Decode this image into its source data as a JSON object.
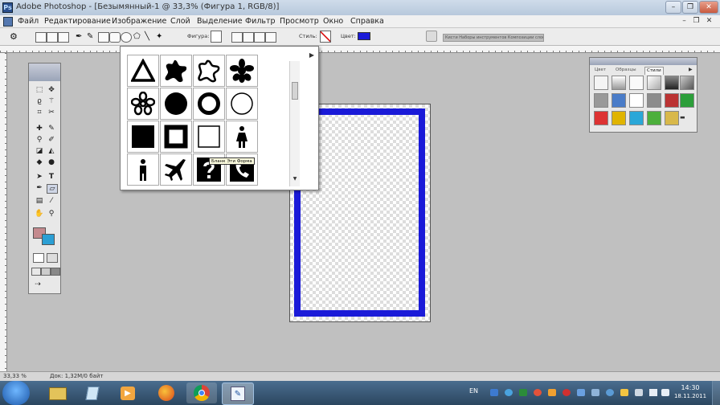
{
  "window": {
    "title": "Adobe Photoshop - [Безымянный-1 @ 33,3% (Фигура 1, RGB/8)]",
    "controls": [
      "–",
      "❐",
      "✕"
    ]
  },
  "menubar": {
    "items": [
      "Файл",
      "Редактирование",
      "Изображение",
      "Слой",
      "Выделение",
      "Фильтр",
      "Просмотр",
      "Окно",
      "Справка"
    ]
  },
  "options_bar": {
    "shape_label": "Фигура:",
    "style_label": "Стиль:",
    "color_label": "Цвет:",
    "color_value": "#1a1ad8",
    "palette_tabs": "Кисти   Наборы инструментов   Композиции слоев"
  },
  "toolbox": {
    "foreground_color": "#c48a8e",
    "background_color": "#2b9fd4"
  },
  "shape_picker": {
    "shapes": [
      "triangle-outline",
      "blob",
      "blob-outline",
      "flower",
      "flower-outline",
      "circle",
      "ring",
      "circle-outline",
      "square",
      "square-frame",
      "square-outline",
      "woman-sign",
      "man-sign",
      "airplane",
      "question-sign",
      "phone-sign"
    ],
    "tooltip": "Бланк Эти Форма"
  },
  "styles_panel": {
    "tabs": [
      "Цвет",
      "Образцы",
      "Стили"
    ],
    "active_tab": "Стили"
  },
  "document": {
    "frame_color": "#1a1ad8"
  },
  "status_bar": {
    "zoom": "33,33 %",
    "doc_info": "Док: 1,32M/0 байт"
  },
  "taskbar": {
    "language": "EN",
    "time": "14:30",
    "date": "18.11.2011"
  }
}
